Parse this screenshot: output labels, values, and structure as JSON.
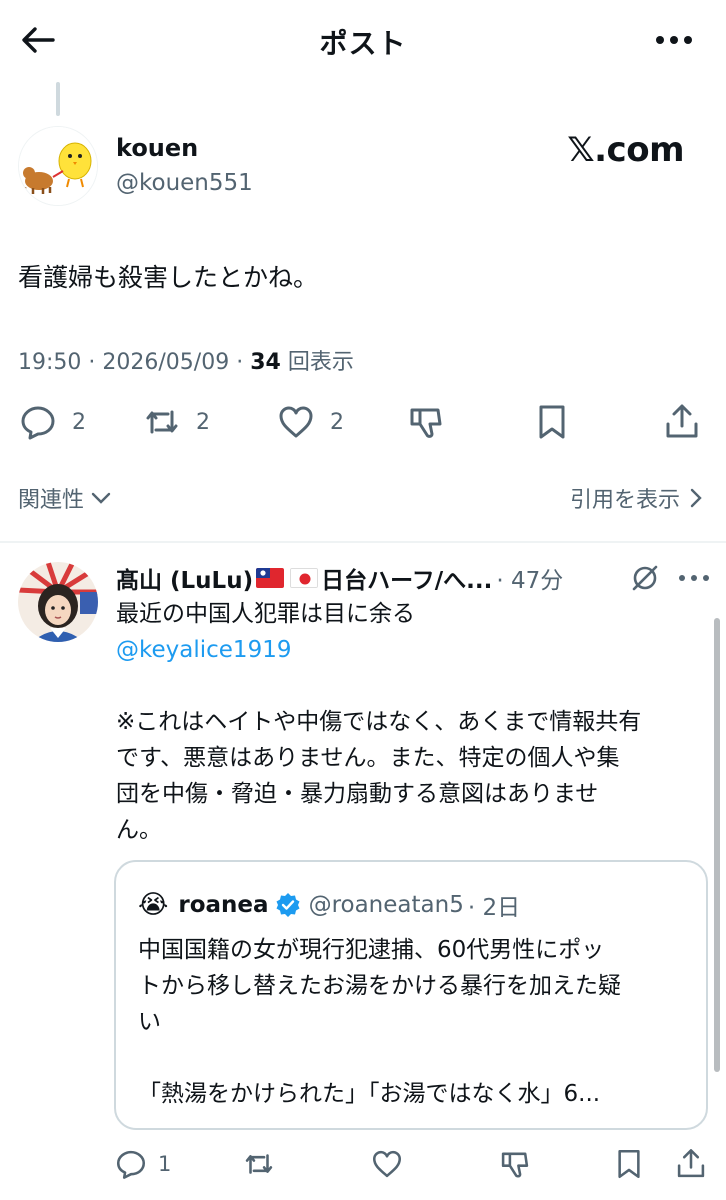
{
  "header": {
    "title": "ポスト"
  },
  "main_post": {
    "name": "kouen",
    "handle": "@kouen551",
    "watermark": "𝕏.com",
    "text": "看護婦も殺害したとかね。",
    "time": "19:50",
    "date": "2026/05/09",
    "views_count": "34",
    "views_label": "回表示",
    "actions": {
      "replies": "2",
      "reposts": "2",
      "likes": "2"
    }
  },
  "links": {
    "related": "関連性",
    "quotes": "引用を表示"
  },
  "reply": {
    "name_prefix": "髙山 (LuLu)",
    "name_suffix": "日台ハーフ/へ...",
    "time": "· 47分",
    "line1": "最近の中国人犯罪は目に余る",
    "mention": "@keyalice1919",
    "line3": "※これはヘイトや中傷ではなく、あくまで情報共有",
    "line4": "です、悪意はありません。また、特定の個人や集",
    "line5": "団を中傷・脅迫・暴力扇動する意図はありませ",
    "line6": "ん。",
    "quote": {
      "emoji": "😭",
      "name": "roanea",
      "handle": "@roaneatan5",
      "time": "· 2日",
      "line1": "中国国籍の女が現行犯逮捕、60代男性にポッ",
      "line2": "トから移し替えたお湯をかける暴行を加えた疑",
      "line3": "い",
      "line4": "「熱湯をかけられた」「お湯ではなく水」6..."
    },
    "actions": {
      "replies": "1"
    }
  },
  "colors": {
    "text": "#0f1419",
    "secondary": "#536471",
    "link": "#1d9bf0",
    "verified": "#1d9bf0",
    "border": "#cfd9de"
  }
}
